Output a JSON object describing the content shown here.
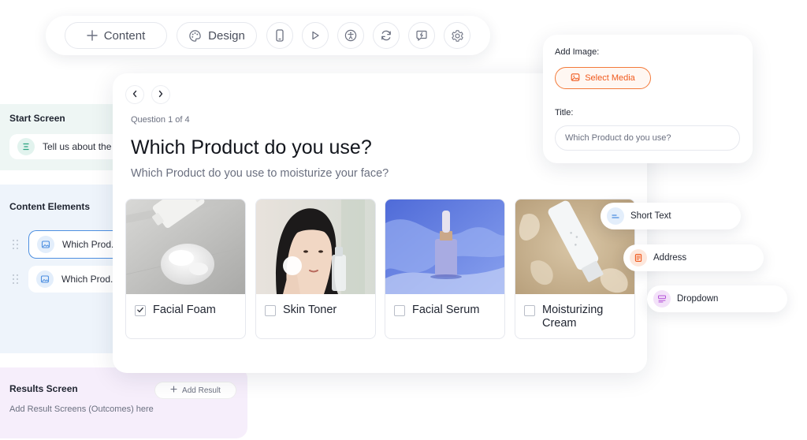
{
  "toolbar": {
    "content_label": "Content",
    "design_label": "Design",
    "icons": [
      "plus-icon",
      "palette-icon",
      "mobile-icon",
      "play-icon",
      "accessibility-icon",
      "refresh-icon",
      "feedback-icon",
      "gear-icon"
    ]
  },
  "start_screen": {
    "title": "Start Screen",
    "item_label": "Tell us about the p"
  },
  "content_elements": {
    "title": "Content Elements",
    "items": [
      {
        "label": "Which Prod..."
      },
      {
        "label": "Which Prod..."
      }
    ]
  },
  "results_screen": {
    "title": "Results Screen",
    "add_button": "Add Result",
    "hint": "Add Result Screens (Outcomes) here"
  },
  "question": {
    "counter": "Question 1 of 4",
    "title": "Which Product do you use?",
    "subtitle": "Which Product do you use to moisturize your face?",
    "options": [
      {
        "label": "Facial Foam",
        "checked": true
      },
      {
        "label": "Skin Toner",
        "checked": false
      },
      {
        "label": "Facial Serum",
        "checked": false
      },
      {
        "label": "Moisturizing Cream",
        "checked": false
      }
    ]
  },
  "settings": {
    "add_image_label": "Add Image:",
    "select_media": "Select Media",
    "title_label": "Title:",
    "title_placeholder": "Which Product do you use?"
  },
  "field_types": [
    {
      "label": "Short Text",
      "color": "#4d8fe0"
    },
    {
      "label": "Address",
      "color": "#f05a1e"
    },
    {
      "label": "Dropdown",
      "color": "#b453d8"
    }
  ],
  "colors": {
    "accent_orange": "#f05a1e",
    "start_bg": "#eef6f4",
    "content_bg": "#eef4fb",
    "results_bg": "#f6eefb",
    "selected_border": "#4d8fe0"
  }
}
